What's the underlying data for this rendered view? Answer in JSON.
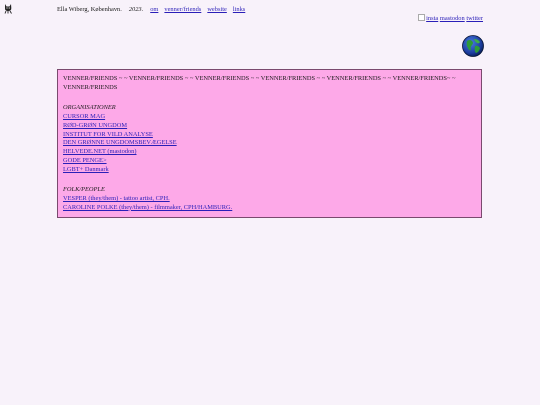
{
  "header": {
    "author": "Ella Wiberg, København.",
    "year": "2023.",
    "nav": [
      {
        "label": "om"
      },
      {
        "label": "venner/friends"
      },
      {
        "label": "website"
      },
      {
        "label": "links"
      }
    ]
  },
  "social": {
    "links": [
      {
        "label": "insta"
      },
      {
        "label": "mastodon"
      },
      {
        "label": "twitter"
      }
    ]
  },
  "icons": {
    "corner": "cat-icon",
    "globe": "globe-icon",
    "broken_image": "broken-image-icon"
  },
  "colors": {
    "background": "#f8f2fa",
    "panel": "#fda9e8",
    "panel_border": "#7a4a6e",
    "link": "#2a1fb8"
  },
  "panel": {
    "heading": "VENNER/FRIENDS ~ ~ VENNER/FRIENDS ~ ~ VENNER/FRIENDS ~ ~ VENNER/FRIENDS ~ ~ VENNER/FRIENDS ~ ~ VENNER/FRIENDS~ ~ VENNER/FRIENDS",
    "sections": [
      {
        "title": "ORGANISATIONER",
        "items": [
          {
            "label": "CURSOR MAG"
          },
          {
            "label": "RØD-GRØN UNGDOM"
          },
          {
            "label": "INSTITUT FOR VILD ANALYSE"
          },
          {
            "label": "DEN GRØNNE UNGDOMSBEVÆGELSE"
          },
          {
            "label": "HELVEDE.NET (mastodon)"
          },
          {
            "label": "GODE PENGE>"
          },
          {
            "label": "LGBT+ Danmark"
          }
        ]
      },
      {
        "title": "FOLK/PEOPLE",
        "items": [
          {
            "label": "VESPER (they/them) - tattoo artist, CPH."
          },
          {
            "label": "CAROLINE POLKE (they/them) - filmmaker, CPH/HAMBURG."
          }
        ]
      }
    ]
  }
}
